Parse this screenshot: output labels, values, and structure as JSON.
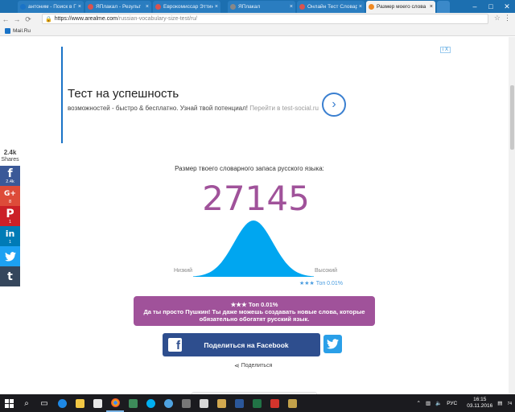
{
  "tabs": [
    {
      "label": "антоним - Поиск в Г",
      "color": "#1a73c7",
      "active": false
    },
    {
      "label": "ЯПлакал - Результ",
      "color": "#d9534f",
      "active": false
    },
    {
      "label": "Еврокомиссар Эттин",
      "color": "#d9534f",
      "active": false
    },
    {
      "label": "ЯПлакал",
      "color": "#888888",
      "active": false
    },
    {
      "label": "Онлайн Тест Словар",
      "color": "#d9534f",
      "active": false
    },
    {
      "label": "Размер моего слова",
      "color": "#f08a24",
      "active": true
    }
  ],
  "toolbar": {
    "url_host": "https://www.arealme.com",
    "url_path": "/russian-vocabulary-size-test/ru/"
  },
  "bookmarks": [
    "Mail.Ru"
  ],
  "ad": {
    "badge": "i X",
    "title": "Тест на успешность",
    "description": "возможностей - быстро & бесплатно. Узнай твой потенциал!",
    "link": "Перейти в test-social.ru"
  },
  "share_bar": {
    "total": "2.4k",
    "total_label": "Shares",
    "items": [
      {
        "name": "facebook",
        "symbol": "f",
        "count": "2.4k",
        "color": "#3b5998"
      },
      {
        "name": "google-plus",
        "symbol": "G+",
        "count": "8",
        "color": "#dd4b39"
      },
      {
        "name": "pinterest",
        "symbol": "P",
        "count": "1",
        "color": "#cb2027"
      },
      {
        "name": "linkedin",
        "symbol": "in",
        "count": "1",
        "color": "#007bb6"
      },
      {
        "name": "twitter",
        "symbol": "t",
        "count": "",
        "color": "#1da1f2"
      },
      {
        "name": "tumblr",
        "symbol": "t",
        "count": "",
        "color": "#35465c"
      }
    ]
  },
  "result": {
    "heading": "Размер твоего словарного запаса русского языка:",
    "score": "27145",
    "low_label": "Низкий",
    "high_label": "Высокий",
    "top_percent": "★★★ Топ 0.01%",
    "box_title": "★★★ Топ 0.01%",
    "box_text": "Да ты просто Пушкин! Ты даже можешь создавать новые слова, которые обязательно обогатят русский язык.",
    "percentile": 0.9999
  },
  "actions": {
    "facebook_label": "Поделиться на Facebook",
    "share_label": "Поделиться"
  },
  "taskbar": {
    "language": "РУС",
    "time": "16:15",
    "date": "03.11.2016",
    "notifications": "74"
  },
  "colors": {
    "accent": "#a0529a",
    "curve": "#00a6f0",
    "facebook": "#2e4e8e",
    "twitter": "#2a9fe8"
  }
}
